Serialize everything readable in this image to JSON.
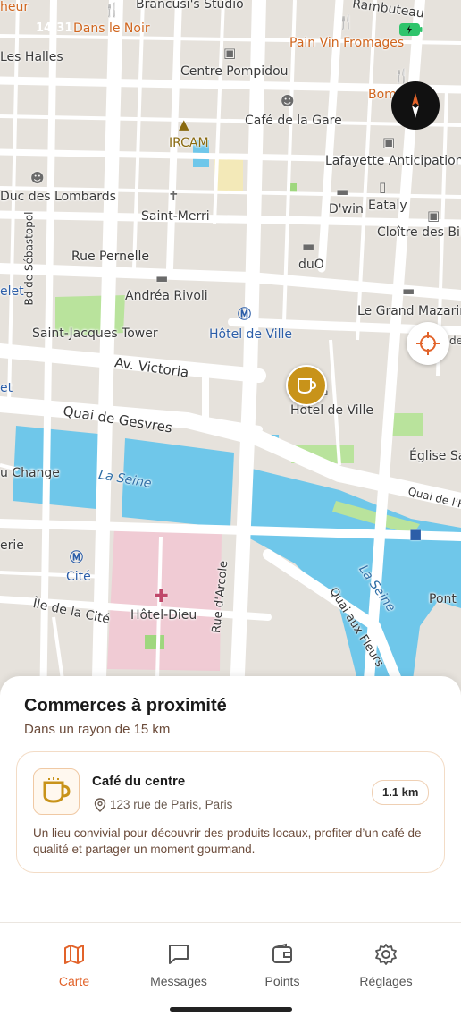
{
  "status_bar": {
    "time": "14:31"
  },
  "map": {
    "labels": {
      "heur": "heur",
      "dans_le_noir": "Dans le Noir",
      "brancusi": "Brancusi's Studio",
      "rambuteau": "Rambuteau",
      "pain_vin": "Pain Vin Fromages",
      "les_halles": "Les Halles",
      "pompidou": "Centre Pompidou",
      "bom": "Bom",
      "cafe_gare": "Café de la Gare",
      "ircam": "IRCAM",
      "lafayette": "Lafayette Anticipations",
      "duc_lombards": "Duc des Lombards",
      "dwin": "D'win",
      "eataly": "Eataly",
      "saint_merri": "Saint-Merri",
      "cloitre": "Cloître des Bill",
      "sebastopol": "Bd de Sébastopol",
      "rue_pernelle": "Rue Pernelle",
      "duo": "duO",
      "elet": "elet",
      "andrea": "Andréa Rivoli",
      "mazarin": "Le Grand Mazarin",
      "hotel_ville_metro": "Hôtel de Ville",
      "st_jacques": "Saint-Jacques Tower",
      "de": "de",
      "victoria": "Av. Victoria",
      "et": "et",
      "hotel_ville": "Hôtel de Ville",
      "gesvres": "Quai de Gesvres",
      "eglise": "Église Sa",
      "change": "u Change",
      "seine1": "La Seine",
      "quai_h": "Quai de l'H",
      "erie": "erie",
      "cite": "Cité",
      "seine2": "La Seine",
      "arcole": "Rue d'Arcole",
      "hotel_dieu": "Hôtel-Dieu",
      "ile_cite": "Île de la Cité",
      "quai_fleurs": "Quai aux Fleurs",
      "pont": "Pont"
    }
  },
  "colors": {
    "accent": "#e2632a",
    "marker": "#c8931a",
    "water": "#6fc7ea",
    "park": "#b9e39c",
    "hospital": "#f0cbd4"
  },
  "sheet": {
    "title": "Commerces à proximité",
    "subtitle": "Dans un rayon de 15 km",
    "shop": {
      "icon": "coffee-cup-icon",
      "name": "Café du centre",
      "address": "123 rue de Paris, Paris",
      "distance": "1.1 km",
      "description": "Un lieu convivial pour découvrir des produits locaux, profiter d’un café de qualité et partager un moment gourmand."
    }
  },
  "tabs": [
    {
      "label": "Carte",
      "icon": "map-icon",
      "active": true
    },
    {
      "label": "Messages",
      "icon": "chat-bubble-icon",
      "active": false
    },
    {
      "label": "Points",
      "icon": "wallet-icon",
      "active": false
    },
    {
      "label": "Réglages",
      "icon": "gear-icon",
      "active": false
    }
  ]
}
